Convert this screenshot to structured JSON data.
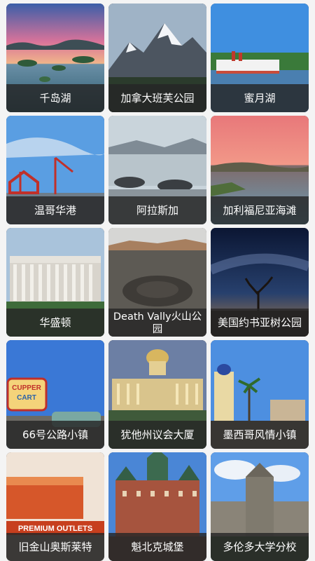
{
  "destinations": [
    {
      "name": "千岛湖",
      "scene": "lake-islands-photo"
    },
    {
      "name": "加拿大班芙公园",
      "scene": "snowy-mountain-photo"
    },
    {
      "name": "蜜月湖",
      "scene": "steamboat-photo"
    },
    {
      "name": "温哥华港",
      "scene": "harbor-cranes-photo"
    },
    {
      "name": "阿拉斯加",
      "scene": "glacier-photo"
    },
    {
      "name": "加利福尼亚海滩",
      "scene": "sunset-coast-photo"
    },
    {
      "name": "华盛顿",
      "scene": "lincoln-memorial-photo"
    },
    {
      "name": "Death Vally火山公园",
      "scene": "volcanic-crater-photo"
    },
    {
      "name": "美国约书亚树公园",
      "scene": "joshua-tree-night-photo"
    },
    {
      "name": "66号公路小镇",
      "scene": "route66-sign-photo"
    },
    {
      "name": "犹他州议会大厦",
      "scene": "capitol-building-photo"
    },
    {
      "name": "墨西哥风情小镇",
      "scene": "mission-tower-photo"
    },
    {
      "name": "旧金山奥斯莱特",
      "scene": "premium-outlets-photo"
    },
    {
      "name": "魁北克城堡",
      "scene": "chateau-castle-photo"
    },
    {
      "name": "多伦多大学分校",
      "scene": "university-tower-photo"
    }
  ],
  "signs": {
    "outlets_top": "PREMIUM OUTLETS",
    "route66_top": "CUPPER",
    "route66_mid": "CART"
  }
}
